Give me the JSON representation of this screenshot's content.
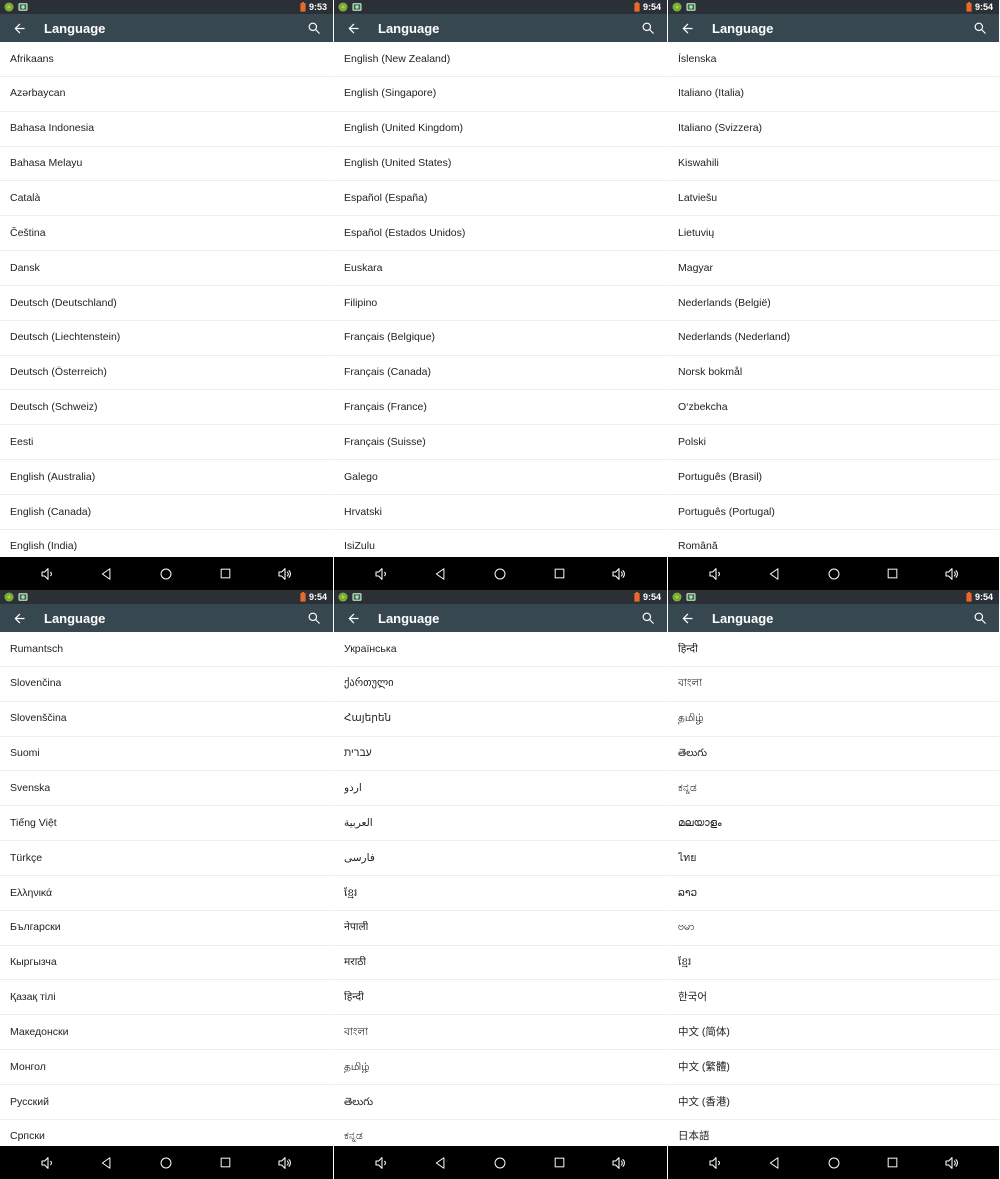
{
  "app": {
    "screen_title": "Language",
    "toolbar_color": "#37474f",
    "statusbar_color": "#2b3036",
    "navbar_color": "#000000",
    "list_background": "#ffffff",
    "divider_color": "#ececec",
    "text_color": "#222222",
    "battery_color": "#e8692a"
  },
  "icons": {
    "back": "arrow-left-icon",
    "search": "search-icon",
    "volume_down": "volume-down-icon",
    "nav_back": "nav-back-triangle-icon",
    "nav_home": "nav-home-circle-icon",
    "nav_recents": "nav-recents-square-icon",
    "volume_up": "volume-up-icon",
    "battery": "battery-icon",
    "notification_sync": "sync-notification-icon",
    "notification_screenshot": "screenshot-notification-icon"
  },
  "panels": [
    {
      "id": "panel-1",
      "title": "Language",
      "time": "9:53",
      "items": [
        "Afrikaans",
        "Azərbaycan",
        "Bahasa Indonesia",
        "Bahasa Melayu",
        "Català",
        "Čeština",
        "Dansk",
        "Deutsch (Deutschland)",
        "Deutsch (Liechtenstein)",
        "Deutsch (Österreich)",
        "Deutsch (Schweiz)",
        "Eesti",
        "English (Australia)",
        "English (Canada)",
        "English (India)"
      ]
    },
    {
      "id": "panel-2",
      "title": "Language",
      "time": "9:54",
      "items": [
        "English (New Zealand)",
        "English (Singapore)",
        "English (United Kingdom)",
        "English (United States)",
        "Español (España)",
        "Español (Estados Unidos)",
        "Euskara",
        "Filipino",
        "Français (Belgique)",
        "Français (Canada)",
        "Français (France)",
        "Français (Suisse)",
        "Galego",
        "Hrvatski",
        "IsiZulu"
      ]
    },
    {
      "id": "panel-3",
      "title": "Language",
      "time": "9:54",
      "items": [
        "Íslenska",
        "Italiano (Italia)",
        "Italiano (Svizzera)",
        "Kiswahili",
        "Latviešu",
        "Lietuvių",
        "Magyar",
        "Nederlands (België)",
        "Nederlands (Nederland)",
        "Norsk bokmål",
        "O‘zbekcha",
        "Polski",
        "Português (Brasil)",
        "Português (Portugal)",
        "Română"
      ]
    },
    {
      "id": "panel-4",
      "title": "Language",
      "time": "9:54",
      "items": [
        "Rumantsch",
        "Slovenčina",
        "Slovenščina",
        "Suomi",
        "Svenska",
        "Tiếng Việt",
        "Türkçe",
        "Ελληνικά",
        "Български",
        "Кыргызча",
        "Қазақ тілі",
        "Македонски",
        "Монгол",
        "Русский",
        "Српски"
      ]
    },
    {
      "id": "panel-5",
      "title": "Language",
      "time": "9:54",
      "items": [
        "Українська",
        "ქართული",
        "Հայերեն",
        "עברית",
        "اردو",
        "العربية",
        "فارسی",
        "ខ្មែរ",
        "नेपाली",
        "मराठी",
        "हिन्दी",
        "বাংলা",
        "தமிழ்",
        "తెలుగు",
        "ಕನ್ನಡ"
      ]
    },
    {
      "id": "panel-6",
      "title": "Language",
      "time": "9:54",
      "items": [
        "हिन्दी",
        "বাংলা",
        "தமிழ்",
        "తెలుగు",
        "ಕನ್ನಡ",
        "മലയാളം",
        "ไทย",
        "ລາວ",
        "ဗမာ",
        "ខ្មែរ",
        "한국어",
        "中文 (简体)",
        "中文 (繁體)",
        "中文 (香港)",
        "日本語"
      ]
    }
  ]
}
